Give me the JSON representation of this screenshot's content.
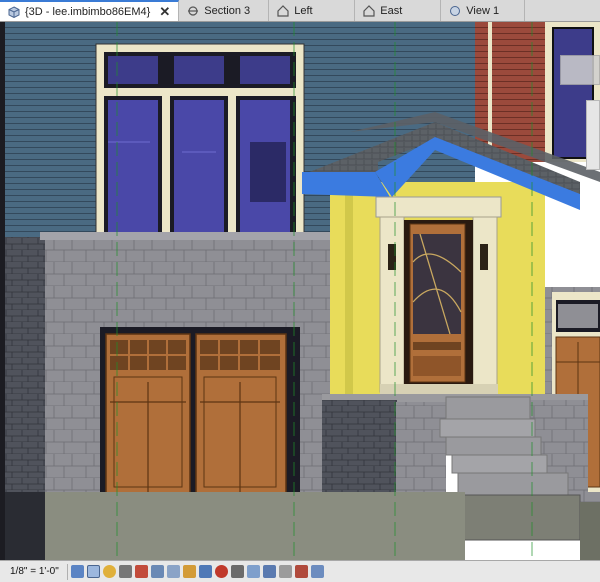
{
  "tabs": [
    {
      "label": "{3D - lee.imbimbo86EM4}",
      "active": true,
      "close": "✕",
      "icon": "3d-view-icon"
    },
    {
      "label": "Section 3",
      "active": false,
      "icon": "section-icon"
    },
    {
      "label": "Left",
      "active": false,
      "icon": "elevation-icon"
    },
    {
      "label": "East",
      "active": false,
      "icon": "elevation-icon"
    },
    {
      "label": "View 1",
      "active": false,
      "icon": "3d-view-icon"
    }
  ],
  "viewbar": {
    "scale": "1/8\" = 1'-0\"",
    "icons": [
      "detail-level-icon",
      "visual-style-icon",
      "sun-path-icon",
      "shadows-icon",
      "render-icon",
      "crop-view-icon",
      "show-crop-icon",
      "unlock-3d-icon",
      "temporary-hide-icon",
      "reveal-hidden-icon",
      "temporary-view-properties-icon",
      "worksharing-display-icon",
      "analytical-model-icon",
      "highlight-displacement-icon",
      "reveal-constraints-icon",
      "hide-analytical-icon"
    ]
  },
  "colors": {
    "siding_blue": "#4a6a82",
    "siding_red": "#9b4a3c",
    "stone": "#8f8f95",
    "stone_dark": "#4d4f57",
    "door_wood": "#b06f3a",
    "porch_wall": "#e8dc5a",
    "roof_edge": "#3b7be0",
    "roof_shingle": "#5c6166",
    "glass": "#3d3c8a",
    "trim": "#ece6c8",
    "ground": "#8a8d80"
  }
}
